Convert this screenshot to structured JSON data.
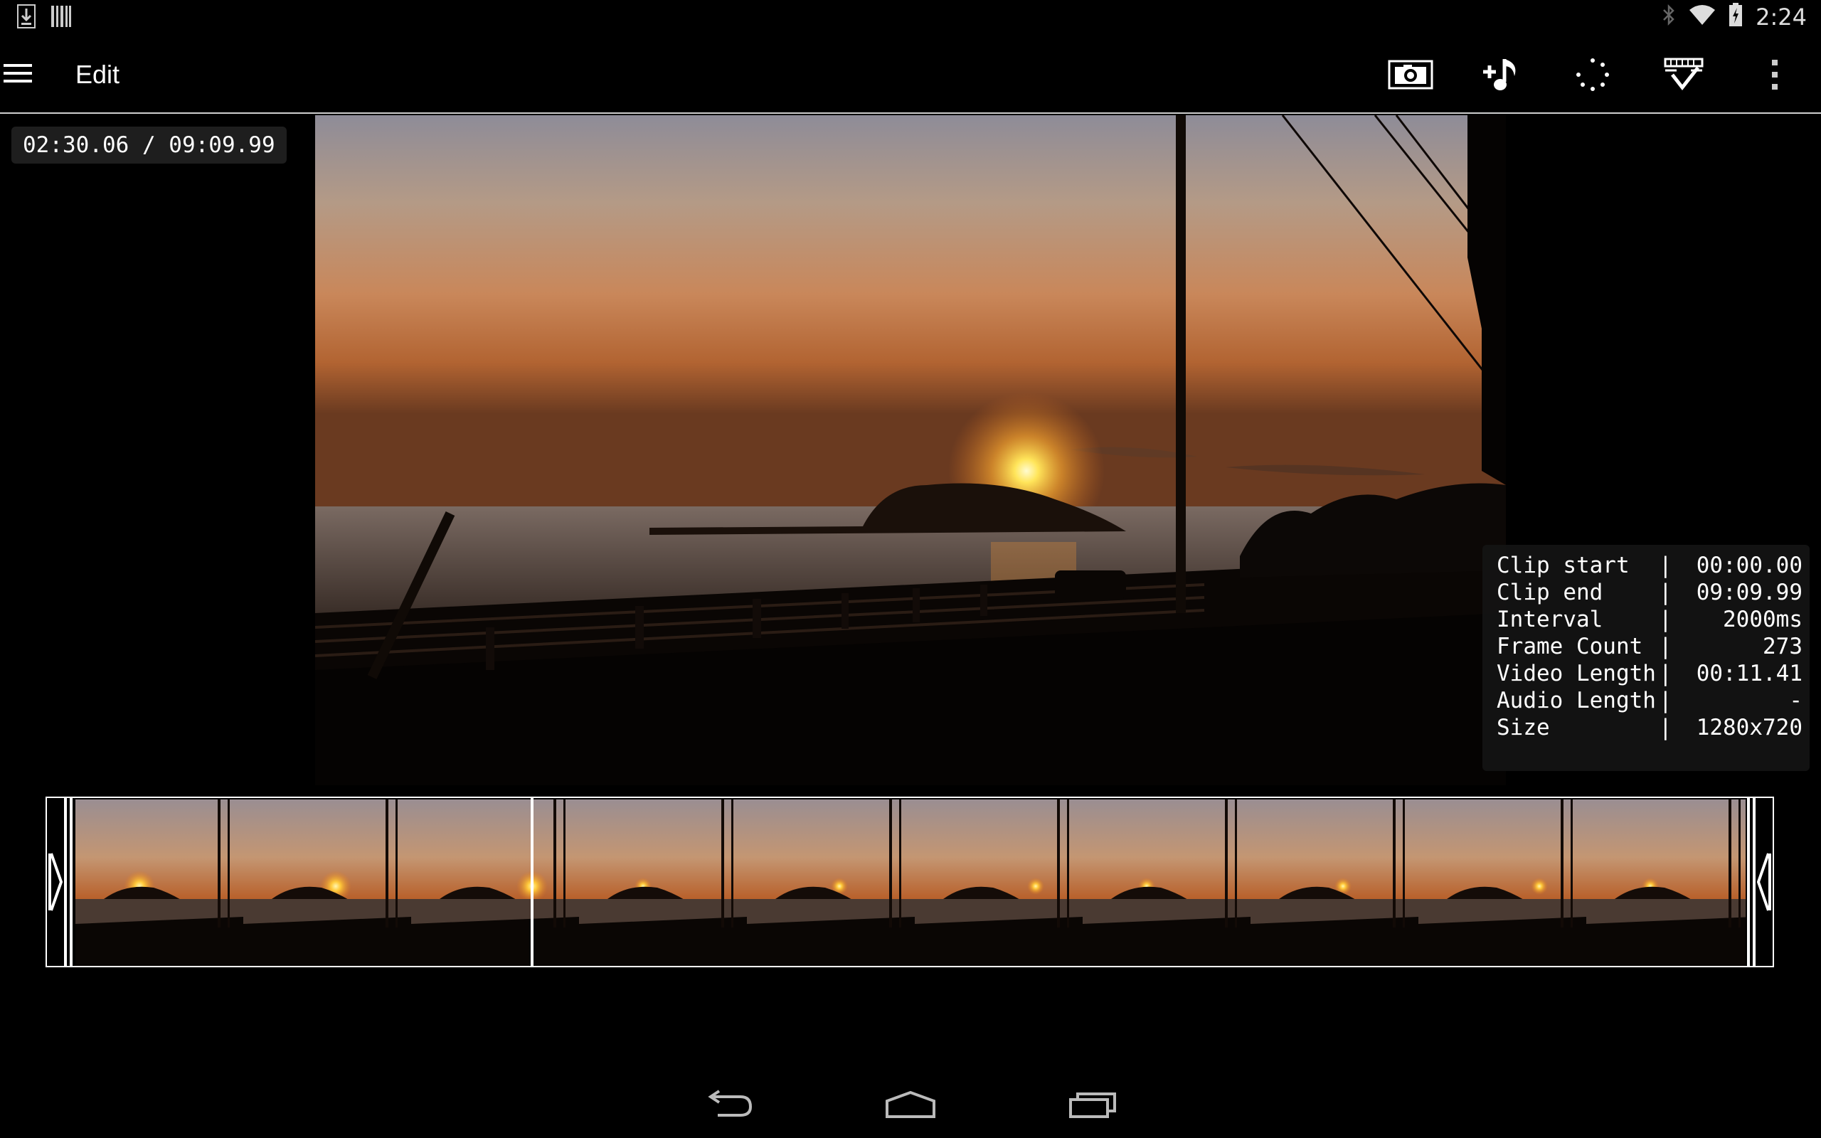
{
  "status_bar": {
    "time": "2:24",
    "icons": [
      "download-icon",
      "barcode-icon",
      "bluetooth-icon",
      "wifi-icon",
      "battery-charging-icon"
    ]
  },
  "action_bar": {
    "title": "Edit",
    "icons": [
      "menu-icon",
      "snapshot-icon",
      "add-music-icon",
      "loading-icon",
      "save-video-icon",
      "overflow-menu-icon"
    ]
  },
  "player": {
    "timecode": "02:30.06 / 09:09.99"
  },
  "info_panel": {
    "rows": [
      {
        "key": "Clip start",
        "value": "00:00.00"
      },
      {
        "key": "Clip end",
        "value": "09:09.99"
      },
      {
        "key": "Interval",
        "value": "2000ms"
      },
      {
        "key": "Frame Count",
        "value": "273"
      },
      {
        "key": "Video Length",
        "value": "00:11.41"
      },
      {
        "key": "Audio Length",
        "value": "-"
      },
      {
        "key": "Size",
        "value": "1280x720"
      }
    ],
    "separator": "|"
  },
  "timeline": {
    "frame_count": 10,
    "playhead_fraction": 0.273
  },
  "nav_bar": {
    "icons": [
      "back-icon",
      "home-icon",
      "recents-icon"
    ]
  },
  "colors": {
    "background": "#000000",
    "text": "#ffffff",
    "overlay": "#1e1e1e"
  }
}
